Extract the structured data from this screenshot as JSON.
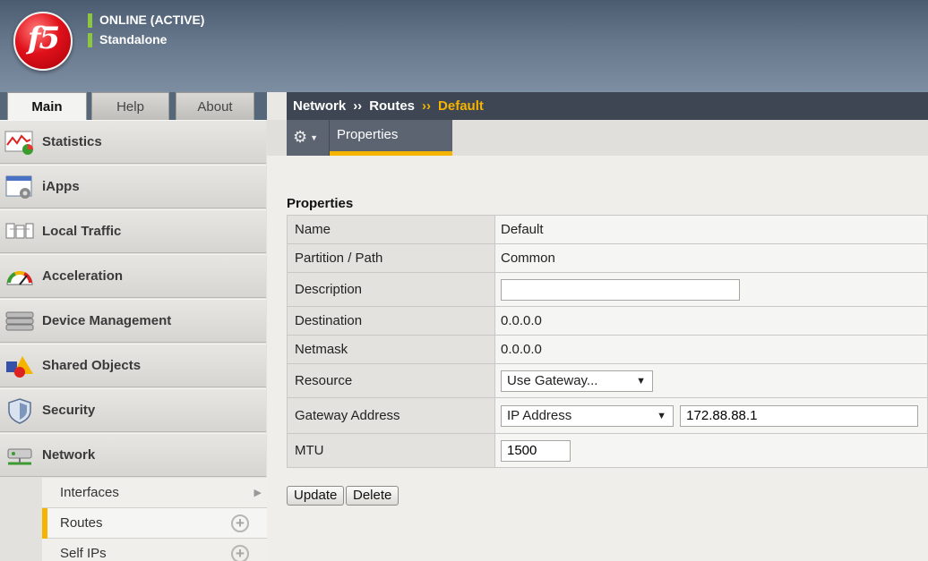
{
  "header": {
    "logo_text": "f5",
    "status_line1": "ONLINE (ACTIVE)",
    "status_line2": "Standalone"
  },
  "tabs": [
    {
      "label": "Main"
    },
    {
      "label": "Help"
    },
    {
      "label": "About"
    }
  ],
  "breadcrumb": {
    "items": [
      "Network",
      "Routes",
      "Default"
    ],
    "separator": "››"
  },
  "sidebar": {
    "items": [
      {
        "label": "Statistics"
      },
      {
        "label": "iApps"
      },
      {
        "label": "Local Traffic"
      },
      {
        "label": "Acceleration"
      },
      {
        "label": "Device Management"
      },
      {
        "label": "Shared Objects"
      },
      {
        "label": "Security"
      },
      {
        "label": "Network"
      }
    ],
    "subitems": [
      {
        "label": "Interfaces"
      },
      {
        "label": "Routes"
      },
      {
        "label": "Self IPs"
      }
    ]
  },
  "toolbar": {
    "gear_icon": "gear-icon",
    "properties_tab": "Properties"
  },
  "properties": {
    "title": "Properties",
    "name_label": "Name",
    "name_value": "Default",
    "partition_label": "Partition / Path",
    "partition_value": "Common",
    "description_label": "Description",
    "description_value": "",
    "destination_label": "Destination",
    "destination_value": "0.0.0.0",
    "netmask_label": "Netmask",
    "netmask_value": "0.0.0.0",
    "resource_label": "Resource",
    "resource_value": "Use Gateway...",
    "gateway_label": "Gateway Address",
    "gateway_type": "IP Address",
    "gateway_value": "172.88.88.1",
    "mtu_label": "MTU",
    "mtu_value": "1500"
  },
  "actions": {
    "update": "Update",
    "delete": "Delete"
  },
  "colors": {
    "accent": "#f5b400",
    "status_green": "#8dc63f",
    "header": "#5a6b80"
  }
}
